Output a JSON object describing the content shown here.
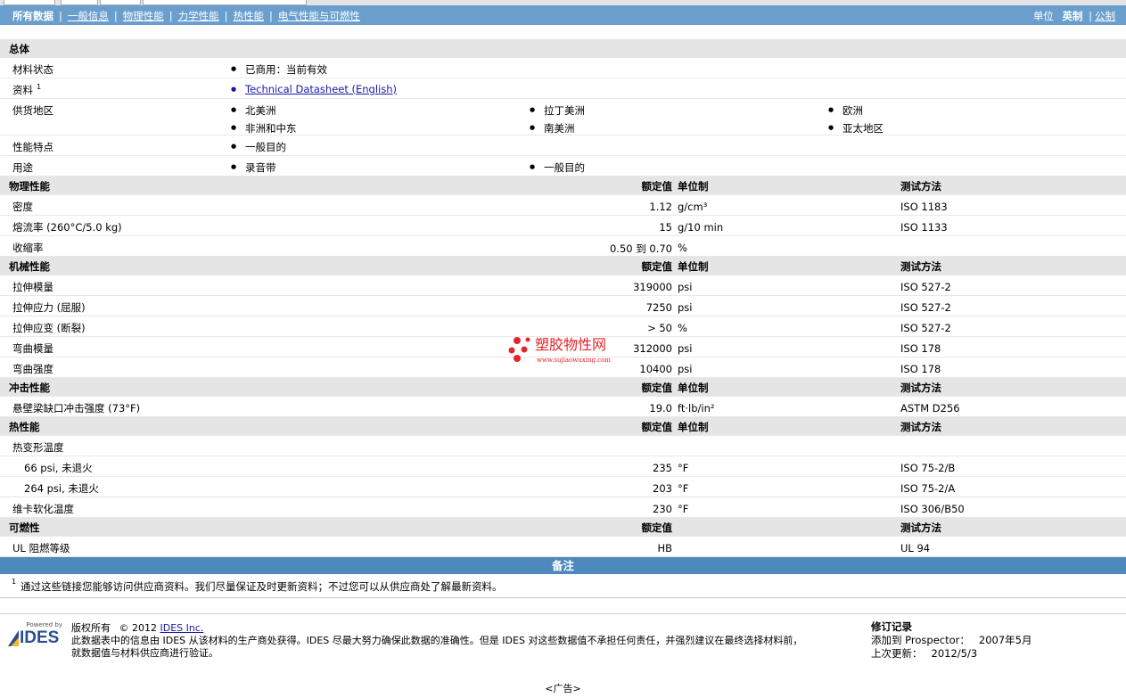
{
  "nav": {
    "tabs": [
      "所有数据",
      "一般信息",
      "物理性能",
      "力学性能",
      "热性能",
      "电气性能与可燃性"
    ],
    "units_label": "单位",
    "unit_selected": "英制",
    "unit_other": "公制"
  },
  "general": {
    "title": "总体",
    "rows": [
      {
        "label": "材料状态",
        "sup": "",
        "values": [
          "已商用：当前有效"
        ]
      },
      {
        "label": "资料",
        "sup": "1",
        "link": "Technical Datasheet (English)"
      },
      {
        "label": "供货地区",
        "sup": "",
        "values": [
          "北美洲",
          "拉丁美洲",
          "欧洲",
          "非洲和中东",
          "南美洲",
          "亚太地区"
        ]
      },
      {
        "label": "性能特点",
        "sup": "",
        "values": [
          "一般目的"
        ]
      },
      {
        "label": "用途",
        "sup": "",
        "values": [
          "录音带",
          "一般目的"
        ]
      }
    ]
  },
  "col_headers": {
    "rated": "额定值",
    "unit": "单位制",
    "method": "测试方法"
  },
  "sections": [
    {
      "title": "物理性能",
      "rows": [
        {
          "label": "密度",
          "value": "1.12",
          "unit": "g/cm³",
          "method": "ISO 1183"
        },
        {
          "label": "熔流率  (260°C/5.0 kg)",
          "value": "15",
          "unit": "g/10 min",
          "method": "ISO 1133"
        },
        {
          "label": "收缩率",
          "value": "0.50 到  0.70",
          "unit": "%",
          "method": ""
        }
      ]
    },
    {
      "title": "机械性能",
      "rows": [
        {
          "label": "拉伸模量",
          "value": "319000",
          "unit": "psi",
          "method": "ISO 527-2"
        },
        {
          "label": "拉伸应力  (屈服)",
          "value": "7250",
          "unit": "psi",
          "method": "ISO 527-2"
        },
        {
          "label": "拉伸应变  (断裂)",
          "value": "> 50",
          "unit": "%",
          "method": "ISO 527-2"
        },
        {
          "label": "弯曲模量",
          "value": "312000",
          "unit": "psi",
          "method": "ISO 178"
        },
        {
          "label": "弯曲强度",
          "value": "10400",
          "unit": "psi",
          "method": "ISO 178"
        }
      ]
    },
    {
      "title": "冲击性能",
      "rows": [
        {
          "label": "悬壁梁缺口冲击强度  (73°F)",
          "value": "19.0",
          "unit": "ft·lb/in²",
          "method": "ASTM D256"
        }
      ]
    },
    {
      "title": "热性能",
      "rows": [
        {
          "label": "热变形温度",
          "value": "",
          "unit": "",
          "method": ""
        },
        {
          "label": "66 psi, 未退火",
          "value": "235",
          "unit": "°F",
          "method": "ISO 75-2/B",
          "indent": true
        },
        {
          "label": "264 psi, 未退火",
          "value": "203",
          "unit": "°F",
          "method": "ISO 75-2/A",
          "indent": true
        },
        {
          "label": "维卡软化温度",
          "value": "230",
          "unit": "°F",
          "method": "ISO 306/B50"
        }
      ]
    },
    {
      "title": "可燃性",
      "rows": [
        {
          "label": "UL 阻燃等级",
          "value": "HB",
          "unit": "",
          "method": "UL 94"
        }
      ]
    }
  ],
  "notes": {
    "title": "备注",
    "items": [
      {
        "sup": "1",
        "text": "通过这些链接您能够访问供应商资料。我们尽量保证及时更新资料；不过您可以从供应商处了解最新资料。"
      }
    ]
  },
  "footer": {
    "powered_by": "Powered by",
    "logo": "IDES",
    "copyright_label": "版权所有",
    "copyright_year": "© 2012",
    "copyright_link": "IDES Inc.",
    "disclaimer_1": "此数据表中的信息由  IDES 从该材料的生产商处获得。IDES 尽最大努力确保此数据的准确性。但是  IDES 对这些数据值不承担任何责任，并强烈建议在最终选择材料前，",
    "disclaimer_2": "就数据值与材料供应商进行验证。",
    "revision_title": "修订记录",
    "added_label": "添加到  Prospector：",
    "added_value": "2007年5月",
    "updated_label": "上次更新：",
    "updated_value": "2012/5/3"
  },
  "watermark": {
    "title": "塑胶物性网",
    "url": "www.sujiaowuxing.com"
  },
  "ad": "<广告>",
  "colors": {
    "nav_bg": "#6a9fcd",
    "notes_bg": "#4d89bd",
    "header_bg": "#e5e5e5",
    "link": "#1a1aa8",
    "watermark_red": "#e3262b"
  }
}
